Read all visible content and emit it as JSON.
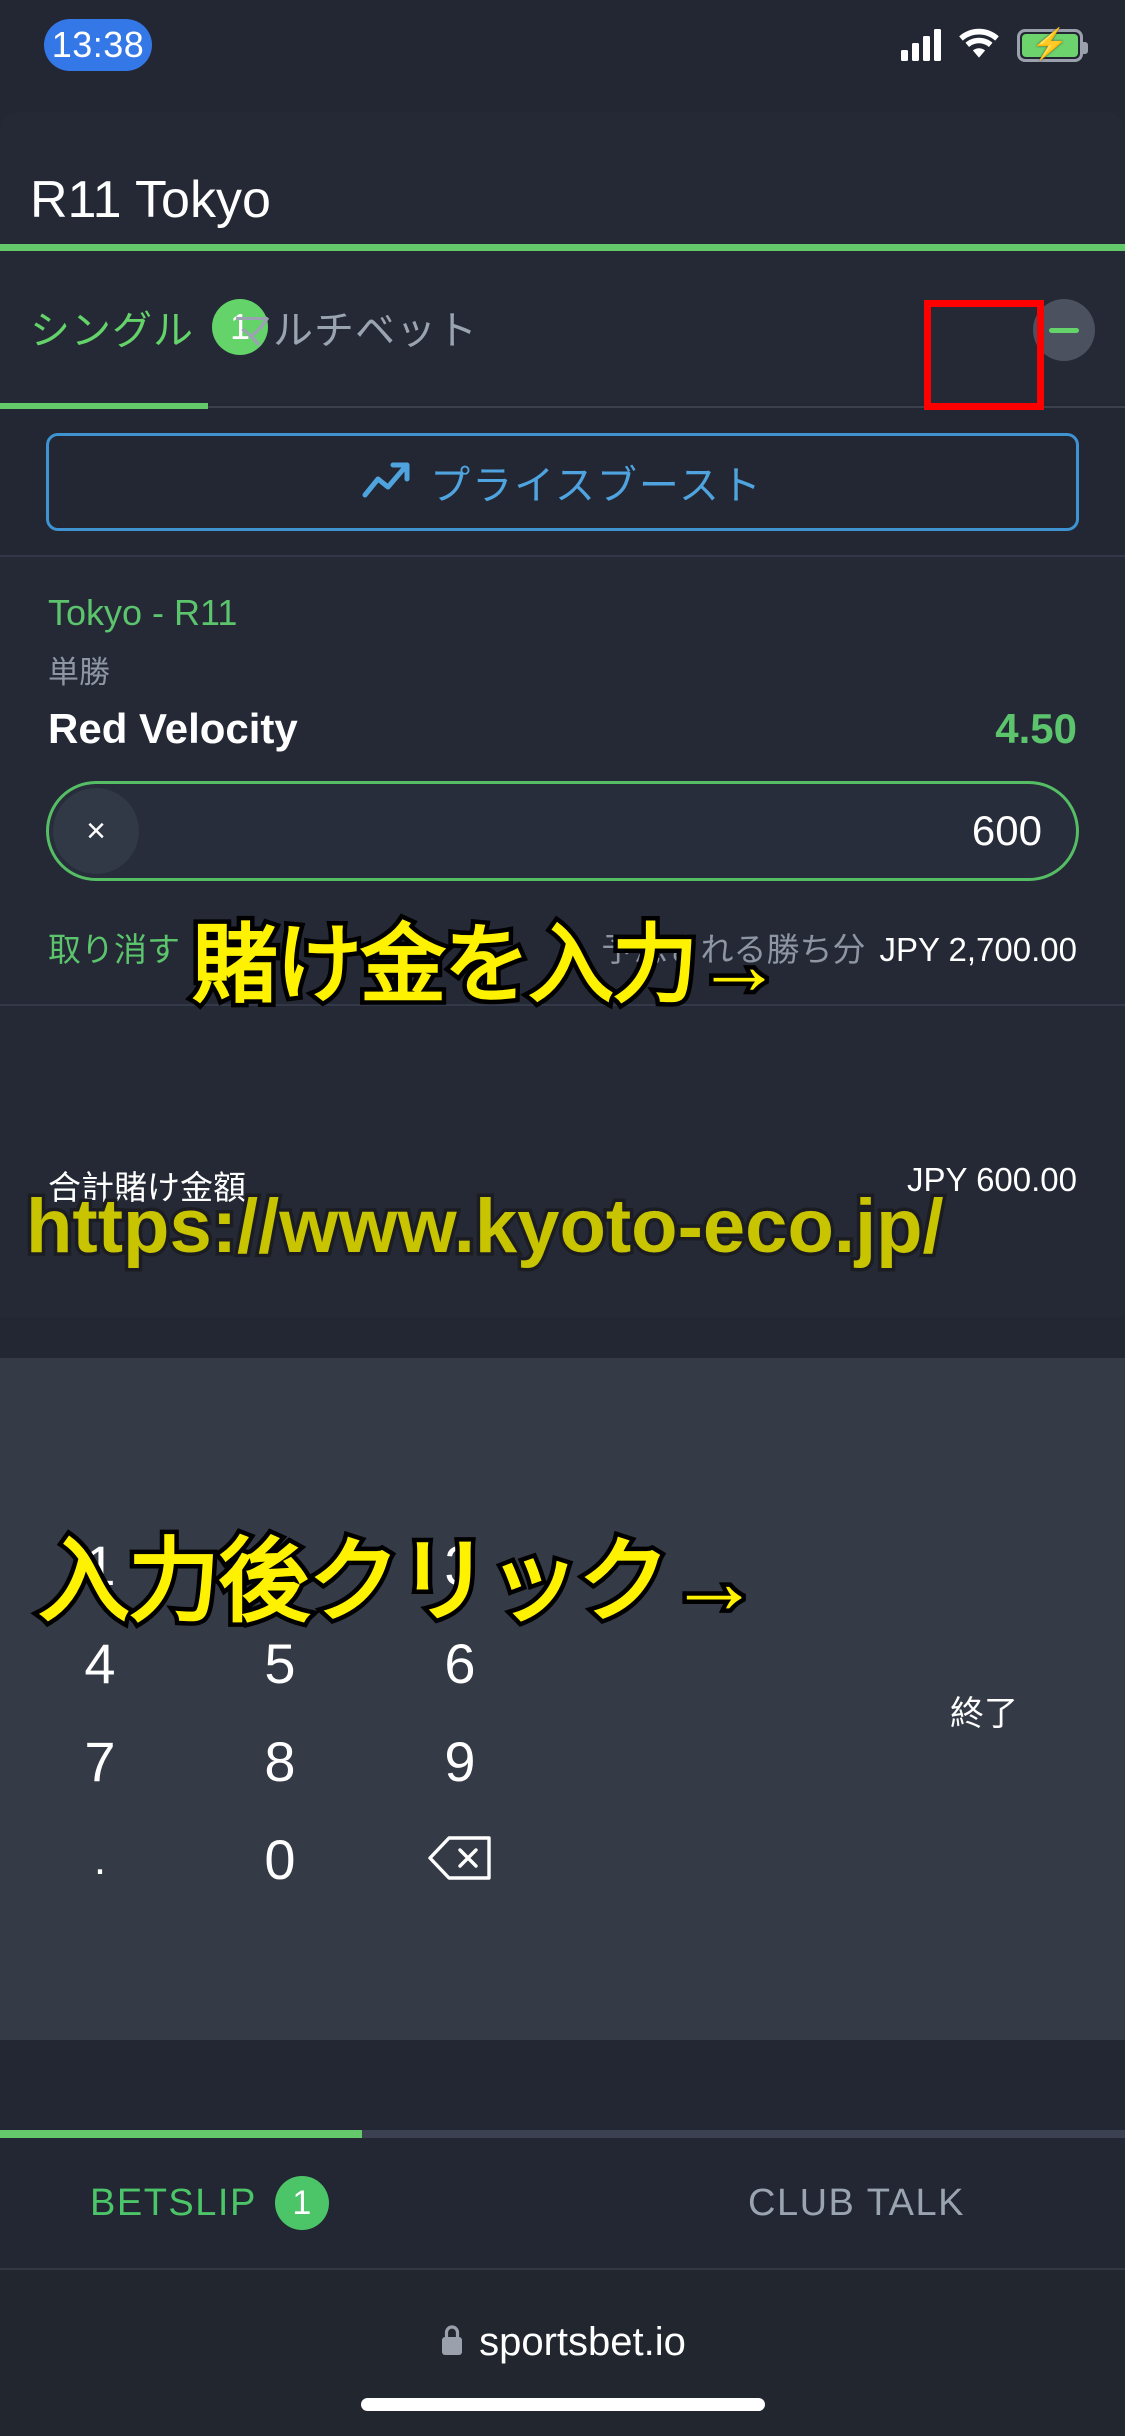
{
  "status_bar": {
    "time": "13:38",
    "signal_icon": "signal-bars-icon",
    "wifi_icon": "wifi-icon",
    "battery_icon": "battery-charging-icon"
  },
  "header": {
    "title": "R11 Tokyo",
    "accent_color": "#63C96A"
  },
  "tabs": [
    {
      "label": "シングル",
      "badge": "1",
      "active": true
    },
    {
      "label": "マルチベット",
      "badge": "",
      "active": false
    }
  ],
  "collapse_button": {
    "icon": "minus-icon"
  },
  "price_boost": {
    "label": "プライスブースト",
    "icon": "trending-up-icon",
    "color": "#4FA3DE"
  },
  "bet": {
    "event": "Tokyo - R11",
    "market": "単勝",
    "selection": "Red Velocity",
    "odds": "4.50",
    "stake_value": "600",
    "clear_icon": "close-x-icon",
    "cancel_label": "取り消す",
    "cancel_icon": "x-mark-icon",
    "payout_label": "予想される勝ち分",
    "payout_value": "JPY 2,700.00",
    "total_label": "合計賭け金額",
    "total_value": "JPY 600.00"
  },
  "keyboard": {
    "keys": [
      [
        "1",
        "2",
        "3"
      ],
      [
        "4",
        "5",
        "6"
      ],
      [
        "7",
        "8",
        "9"
      ],
      [
        ".",
        "0",
        "backspace-icon"
      ]
    ],
    "done_label": "終了",
    "backspace_icon": "backspace-delete-icon",
    "highlight_color": "#FF0000"
  },
  "bottom_nav": [
    {
      "label": "BETSLIP",
      "badge": "1",
      "active": true
    },
    {
      "label": "CLUB TALK",
      "badge": "",
      "active": false
    }
  ],
  "browser": {
    "url": "sportsbet.io",
    "lock_icon": "lock-icon"
  },
  "annotations": {
    "stake_hint": "賭け金を入力→",
    "click_hint": "入力後クリック→",
    "watermark": "https://www.kyoto-eco.jp/"
  }
}
